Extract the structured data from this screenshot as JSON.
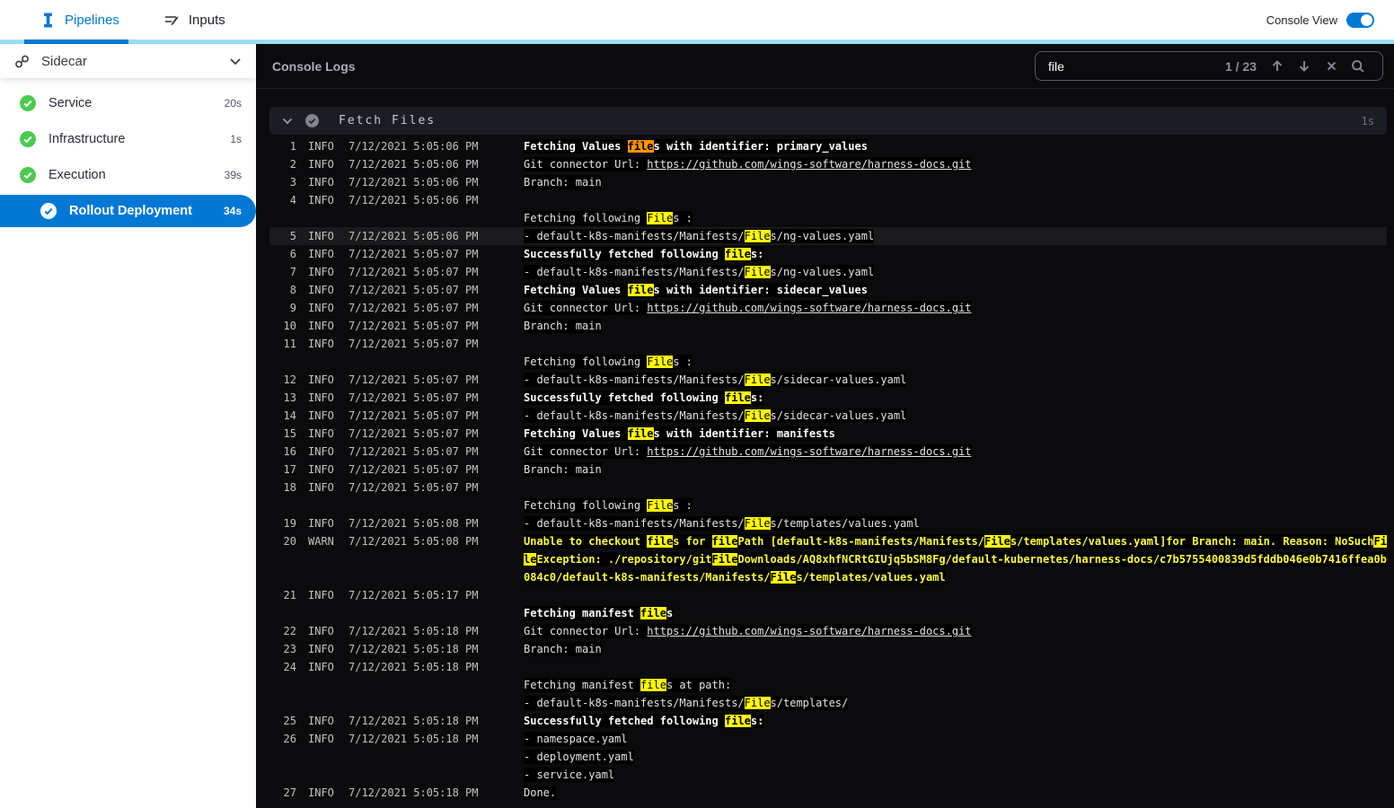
{
  "colors": {
    "primary_blue": "#0278d5",
    "tab_track_blue": "#9ddcf3",
    "success_green": "#4dc952",
    "console_bg": "#0b0b0d",
    "match_yellow": "#ffff00",
    "current_match_orange": "#ff9300",
    "warn_yellow": "#fcfc3c"
  },
  "topbar": {
    "tabs": [
      {
        "label": "Pipelines",
        "active": true
      },
      {
        "label": "Inputs",
        "active": false
      }
    ],
    "console_view_label": "Console View",
    "console_view_on": true
  },
  "sidebar": {
    "title": "Sidecar",
    "stages": [
      {
        "label": "Service",
        "duration": "20s",
        "status": "success",
        "selected": false
      },
      {
        "label": "Infrastructure",
        "duration": "1s",
        "status": "success",
        "selected": false
      },
      {
        "label": "Execution",
        "duration": "39s",
        "status": "success",
        "selected": false
      },
      {
        "label": "Rollout Deployment",
        "duration": "34s",
        "status": "success",
        "selected": true
      }
    ]
  },
  "console": {
    "title": "Console Logs",
    "search": {
      "query": "file",
      "counter": "1 / 23"
    },
    "section": {
      "title": "Fetch Files",
      "duration": "1s"
    },
    "logs": [
      {
        "num": "1",
        "level": "INFO",
        "time": "7/12/2021 5:05:06 PM",
        "lines": [
          [
            [
              "b",
              "Fetching Values "
            ],
            [
              "ho",
              "file"
            ],
            [
              "b",
              "s with identifier: primary_values"
            ]
          ]
        ]
      },
      {
        "num": "2",
        "level": "INFO",
        "time": "7/12/2021 5:05:06 PM",
        "lines": [
          [
            [
              "n",
              "Git connector Url: "
            ],
            [
              "l",
              "https://github.com/wings-software/harness-docs.git"
            ]
          ]
        ]
      },
      {
        "num": "3",
        "level": "INFO",
        "time": "7/12/2021 5:05:06 PM",
        "lines": [
          [
            [
              "n",
              "Branch: main"
            ]
          ]
        ]
      },
      {
        "num": "4",
        "level": "INFO",
        "time": "7/12/2021 5:05:06 PM",
        "lines": [
          [],
          [
            [
              "n",
              "Fetching following "
            ],
            [
              "hy",
              "File"
            ],
            [
              "n",
              "s :"
            ]
          ]
        ]
      },
      {
        "num": "5",
        "level": "INFO",
        "time": "7/12/2021 5:05:06 PM",
        "highlight_row": true,
        "lines": [
          [
            [
              "n",
              "- default-k8s-manifests/Manifests/"
            ],
            [
              "hy",
              "File"
            ],
            [
              "n",
              "s/ng-values.yaml"
            ]
          ]
        ]
      },
      {
        "num": "6",
        "level": "INFO",
        "time": "7/12/2021 5:05:07 PM",
        "lines": [
          [
            [
              "b",
              "Successfully fetched following "
            ],
            [
              "hyb",
              "file"
            ],
            [
              "b",
              "s:"
            ]
          ]
        ]
      },
      {
        "num": "7",
        "level": "INFO",
        "time": "7/12/2021 5:05:07 PM",
        "lines": [
          [
            [
              "n",
              "- default-k8s-manifests/Manifests/"
            ],
            [
              "hy",
              "File"
            ],
            [
              "n",
              "s/ng-values.yaml"
            ]
          ]
        ]
      },
      {
        "num": "8",
        "level": "INFO",
        "time": "7/12/2021 5:05:07 PM",
        "lines": [
          [
            [
              "b",
              "Fetching Values "
            ],
            [
              "hyb",
              "file"
            ],
            [
              "b",
              "s with identifier: sidecar_values"
            ]
          ]
        ]
      },
      {
        "num": "9",
        "level": "INFO",
        "time": "7/12/2021 5:05:07 PM",
        "lines": [
          [
            [
              "n",
              "Git connector Url: "
            ],
            [
              "l",
              "https://github.com/wings-software/harness-docs.git"
            ]
          ]
        ]
      },
      {
        "num": "10",
        "level": "INFO",
        "time": "7/12/2021 5:05:07 PM",
        "lines": [
          [
            [
              "n",
              "Branch: main"
            ]
          ]
        ]
      },
      {
        "num": "11",
        "level": "INFO",
        "time": "7/12/2021 5:05:07 PM",
        "lines": [
          [],
          [
            [
              "n",
              "Fetching following "
            ],
            [
              "hy",
              "File"
            ],
            [
              "n",
              "s :"
            ]
          ]
        ]
      },
      {
        "num": "12",
        "level": "INFO",
        "time": "7/12/2021 5:05:07 PM",
        "lines": [
          [
            [
              "n",
              "- default-k8s-manifests/Manifests/"
            ],
            [
              "hy",
              "File"
            ],
            [
              "n",
              "s/sidecar-values.yaml"
            ]
          ]
        ]
      },
      {
        "num": "13",
        "level": "INFO",
        "time": "7/12/2021 5:05:07 PM",
        "lines": [
          [
            [
              "b",
              "Successfully fetched following "
            ],
            [
              "hyb",
              "file"
            ],
            [
              "b",
              "s:"
            ]
          ]
        ]
      },
      {
        "num": "14",
        "level": "INFO",
        "time": "7/12/2021 5:05:07 PM",
        "lines": [
          [
            [
              "n",
              "- default-k8s-manifests/Manifests/"
            ],
            [
              "hy",
              "File"
            ],
            [
              "n",
              "s/sidecar-values.yaml"
            ]
          ]
        ]
      },
      {
        "num": "15",
        "level": "INFO",
        "time": "7/12/2021 5:05:07 PM",
        "lines": [
          [
            [
              "b",
              "Fetching Values "
            ],
            [
              "hyb",
              "file"
            ],
            [
              "b",
              "s with identifier: manifests"
            ]
          ]
        ]
      },
      {
        "num": "16",
        "level": "INFO",
        "time": "7/12/2021 5:05:07 PM",
        "lines": [
          [
            [
              "n",
              "Git connector Url: "
            ],
            [
              "l",
              "https://github.com/wings-software/harness-docs.git"
            ]
          ]
        ]
      },
      {
        "num": "17",
        "level": "INFO",
        "time": "7/12/2021 5:05:07 PM",
        "lines": [
          [
            [
              "n",
              "Branch: main"
            ]
          ]
        ]
      },
      {
        "num": "18",
        "level": "INFO",
        "time": "7/12/2021 5:05:07 PM",
        "lines": [
          [],
          [
            [
              "n",
              "Fetching following "
            ],
            [
              "hy",
              "File"
            ],
            [
              "n",
              "s :"
            ]
          ]
        ]
      },
      {
        "num": "19",
        "level": "INFO",
        "time": "7/12/2021 5:05:08 PM",
        "lines": [
          [
            [
              "n",
              "- default-k8s-manifests/Manifests/"
            ],
            [
              "hy",
              "File"
            ],
            [
              "n",
              "s/templates/values.yaml"
            ]
          ]
        ]
      },
      {
        "num": "20",
        "level": "WARN",
        "time": "7/12/2021 5:05:08 PM",
        "lines": [
          [
            [
              "w",
              "Unable to checkout "
            ],
            [
              "hyw",
              "file"
            ],
            [
              "w",
              "s for "
            ],
            [
              "hyw",
              "file"
            ],
            [
              "w",
              "Path [default-k8s-manifests/Manifests/"
            ],
            [
              "hyw",
              "File"
            ],
            [
              "w",
              "s/templates/values.yaml]for Branch: main. Reason: NoSuch"
            ],
            [
              "hyw",
              "File"
            ],
            [
              "w",
              "Exception: ./repository/git"
            ],
            [
              "hyw",
              "File"
            ],
            [
              "w",
              "Downloads/AQ8xhfNCRtGIUjq5bSM8Fg/default-kubernetes/harness-docs/c7b5755400839d5fddb046e0b7416ffea0b084c0/default-k8s-manifests/Manifests/"
            ],
            [
              "hyw",
              "File"
            ],
            [
              "w",
              "s/templates/values.yaml"
            ]
          ]
        ]
      },
      {
        "num": "21",
        "level": "INFO",
        "time": "7/12/2021 5:05:17 PM",
        "lines": [
          [],
          [
            [
              "b",
              "Fetching manifest "
            ],
            [
              "hyb",
              "file"
            ],
            [
              "b",
              "s"
            ]
          ]
        ]
      },
      {
        "num": "22",
        "level": "INFO",
        "time": "7/12/2021 5:05:18 PM",
        "lines": [
          [
            [
              "n",
              "Git connector Url: "
            ],
            [
              "l",
              "https://github.com/wings-software/harness-docs.git"
            ]
          ]
        ]
      },
      {
        "num": "23",
        "level": "INFO",
        "time": "7/12/2021 5:05:18 PM",
        "lines": [
          [
            [
              "n",
              "Branch: main"
            ]
          ]
        ]
      },
      {
        "num": "24",
        "level": "INFO",
        "time": "7/12/2021 5:05:18 PM",
        "lines": [
          [],
          [
            [
              "n",
              "Fetching manifest "
            ],
            [
              "hy",
              "file"
            ],
            [
              "n",
              "s at path:"
            ]
          ],
          [
            [
              "n",
              "- default-k8s-manifests/Manifests/"
            ],
            [
              "hy",
              "File"
            ],
            [
              "n",
              "s/templates/"
            ]
          ]
        ]
      },
      {
        "num": "25",
        "level": "INFO",
        "time": "7/12/2021 5:05:18 PM",
        "lines": [
          [
            [
              "b",
              "Successfully fetched following "
            ],
            [
              "hyb",
              "file"
            ],
            [
              "b",
              "s:"
            ]
          ]
        ]
      },
      {
        "num": "26",
        "level": "INFO",
        "time": "7/12/2021 5:05:18 PM",
        "lines": [
          [
            [
              "n",
              "- namespace.yaml"
            ]
          ],
          [
            [
              "n",
              "- deployment.yaml"
            ]
          ],
          [
            [
              "n",
              "- service.yaml"
            ]
          ]
        ]
      },
      {
        "num": "27",
        "level": "INFO",
        "time": "7/12/2021 5:05:18 PM",
        "lines": [
          [
            [
              "n",
              "Done."
            ]
          ]
        ]
      }
    ]
  }
}
